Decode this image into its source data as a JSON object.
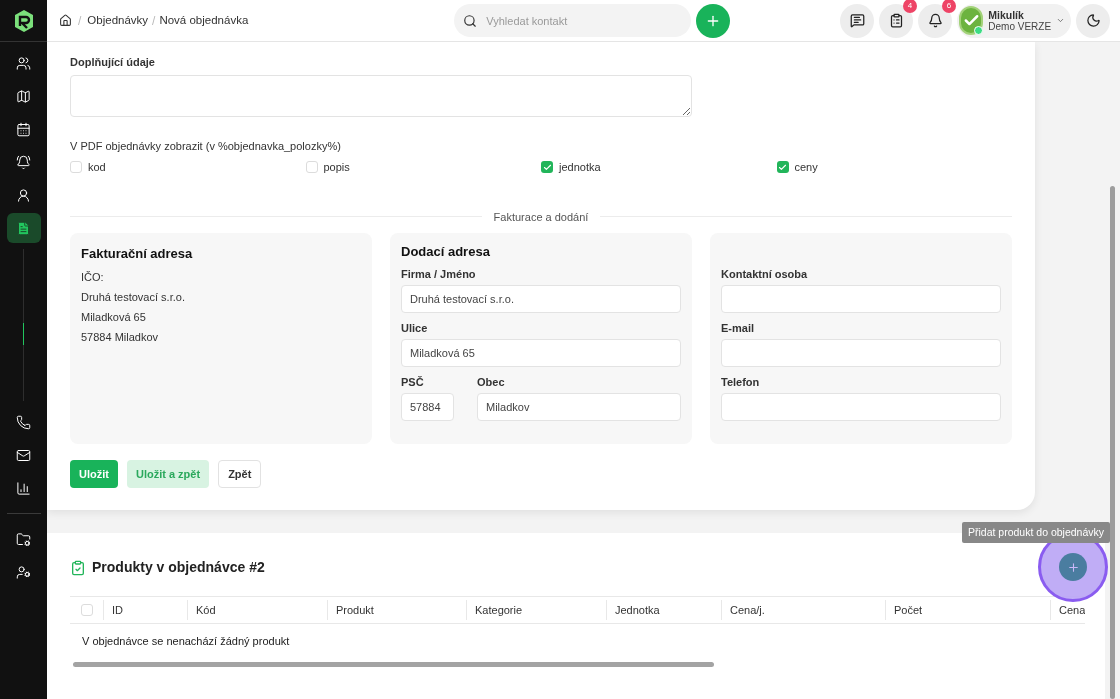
{
  "sidebar": {
    "items": [
      {
        "kind": "users",
        "selected": false
      },
      {
        "kind": "map",
        "selected": false
      },
      {
        "kind": "calendar",
        "selected": false
      },
      {
        "kind": "bell",
        "selected": false
      },
      {
        "kind": "contacts",
        "selected": false
      },
      {
        "kind": "document",
        "selected": true
      },
      {
        "kind": "phone",
        "selected": false
      },
      {
        "kind": "mail",
        "selected": false
      },
      {
        "kind": "chart",
        "selected": false
      }
    ],
    "bottom_items": [
      {
        "kind": "folder-settings",
        "selected": false
      },
      {
        "kind": "user-settings",
        "selected": false
      }
    ]
  },
  "breadcrumbs": [
    "Objednávky",
    "Nová objednávka"
  ],
  "breadcrumb_separator": "/",
  "search": {
    "placeholder": "Vyhledat kontakt"
  },
  "header_buttons": [
    {
      "kind": "messages"
    },
    {
      "kind": "tasks",
      "badge": "4"
    },
    {
      "kind": "notifications",
      "badge": "6"
    }
  ],
  "user": {
    "name": "Mikulík",
    "subtitle": "Demo VERZE",
    "online": true
  },
  "form": {
    "extra_label": "Doplňující údaje",
    "pdf_label": "V PDF objednávky zobrazit (v %objednavka_polozky%)",
    "pdf_options": [
      {
        "label": "kod",
        "checked": false
      },
      {
        "label": "popis",
        "checked": false
      },
      {
        "label": "jednotka",
        "checked": true
      },
      {
        "label": "ceny",
        "checked": true
      }
    ],
    "section_title": "Fakturace a dodání",
    "billing": {
      "title": "Fakturační adresa",
      "lines": [
        "IČO:",
        "Druhá testovací s.r.o.",
        "Miladková 65",
        "57884 Miladkov"
      ]
    },
    "delivery": {
      "title": "Dodací adresa",
      "company": {
        "label": "Firma / Jméno",
        "value": "Druhá testovací s.r.o."
      },
      "street": {
        "label": "Ulice",
        "value": "Miladková 65"
      },
      "zip": {
        "label": "PSČ",
        "value": "57884"
      },
      "city": {
        "label": "Obec",
        "value": "Miladkov"
      }
    },
    "contact": {
      "fields": [
        {
          "label": "Kontaktní osoba"
        },
        {
          "label": "E-mail"
        },
        {
          "label": "Telefon"
        }
      ]
    },
    "buttons": [
      {
        "label": "Uložit",
        "kind": "primary"
      },
      {
        "label": "Uložit a zpět",
        "kind": "secondary"
      },
      {
        "label": "Zpět",
        "kind": "outline"
      }
    ]
  },
  "products": {
    "header_checkbox": {
      "checked": false
    },
    "title": "Produkty v objednávce #2",
    "columns": [
      "ID",
      "Kód",
      "Produkt",
      "Kategorie",
      "Jednotka",
      "Cena/j.",
      "Počet",
      "Cena"
    ],
    "empty_text": "V objednávce se nenachází žádný produkt",
    "tooltip": "Přidat produkt do objednávky"
  }
}
